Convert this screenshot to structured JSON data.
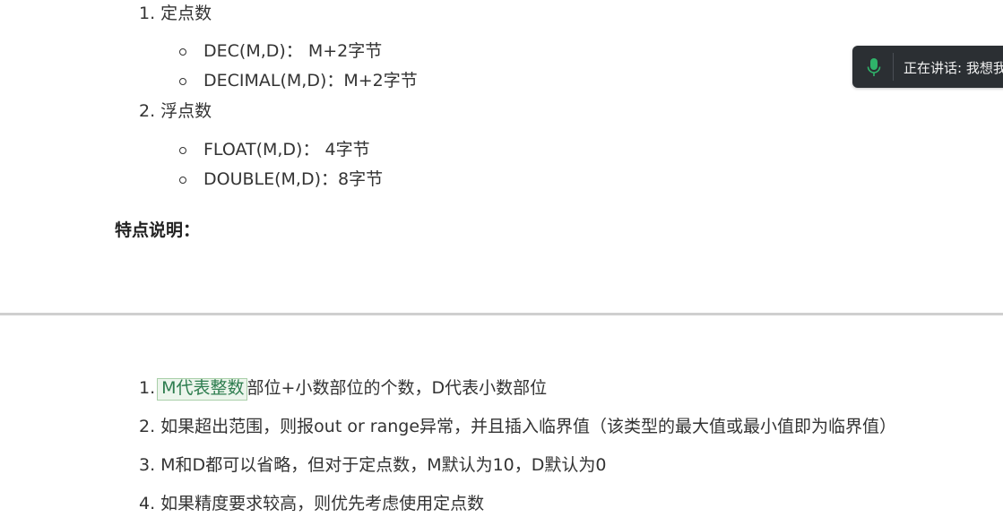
{
  "doc": {
    "top_list": [
      {
        "label": "1. 定点数",
        "items": [
          "DEC(M,D)： M+2字节",
          "DECIMAL(M,D)：M+2字节"
        ]
      },
      {
        "label": "2. 浮点数",
        "items": [
          "FLOAT(M,D)： 4字节",
          "DOUBLE(M,D)：8字节"
        ]
      }
    ],
    "features_heading": "特点说明：",
    "notes": {
      "n1_prefix": "1.",
      "n1_highlight": "M代表整数",
      "n1_rest": "部位+小数部位的个数，D代表小数部位",
      "n2": "2. 如果超出范围，则报out or range异常，并且插入临界值（该类型的最大值或最小值即为临界值）",
      "n3": "3. M和D都可以省略，但对于定点数，M默认为10，D默认为0",
      "n4": "4. 如果精度要求较高，则优先考虑使用定点数"
    }
  },
  "speaking": {
    "text": "正在讲话: 我想我",
    "icon": "microphone-icon",
    "mic_color": "#2fb36a"
  }
}
